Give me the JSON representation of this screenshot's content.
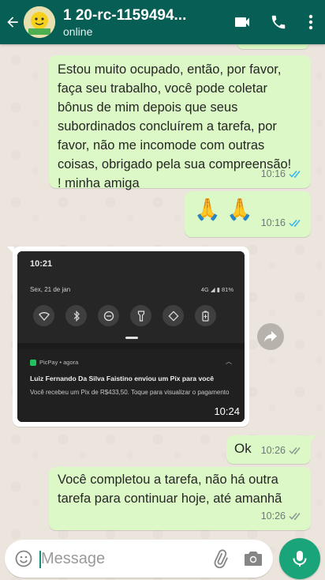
{
  "header": {
    "title": "1 20-rc-1159494...",
    "status": "online"
  },
  "messages": [
    {
      "direction": "out",
      "text": "Estou muito ocupado, então, por favor, faça seu trabalho, você pode coletar bônus de mim depois que seus subordinados concluírem a tarefa, por favor, não me incomode com outras coisas, obrigado pela sua compreensão! ! minha amiga",
      "time": "10:16",
      "ticks": "read"
    },
    {
      "direction": "out",
      "text": "🙏 🙏",
      "time": "10:16",
      "ticks": "read"
    },
    {
      "direction": "in",
      "type": "image",
      "image": {
        "clock": "10:21",
        "date": "Sex, 21 de jan",
        "network": "4G",
        "battery": "81%",
        "notif_app": "PicPay • agora",
        "notif_title": "Luiz Fernando Da Silva Faistino enviou um Pix para você",
        "notif_body": "Você recebeu um Pix de R$433,50. Toque para visualizar o pagamento"
      },
      "time": "10:24"
    },
    {
      "direction": "out",
      "text": "Ok",
      "time": "10:26",
      "ticks": "delivered"
    },
    {
      "direction": "out",
      "text": "Você completou a tarefa, não há outra tarefa para continuar hoje, até amanhã",
      "time": "10:26",
      "ticks": "delivered"
    }
  ],
  "composer": {
    "placeholder": "Message"
  },
  "colors": {
    "header": "#075e54",
    "outgoing_bubble": "#dcf8c6",
    "read_ticks": "#34b7f1",
    "mic_button": "#1aa47a"
  },
  "icons": [
    "back-arrow-icon",
    "video-call-icon",
    "phone-icon",
    "more-vert-icon",
    "emoji-icon",
    "attach-icon",
    "camera-icon",
    "mic-icon",
    "forward-icon"
  ]
}
